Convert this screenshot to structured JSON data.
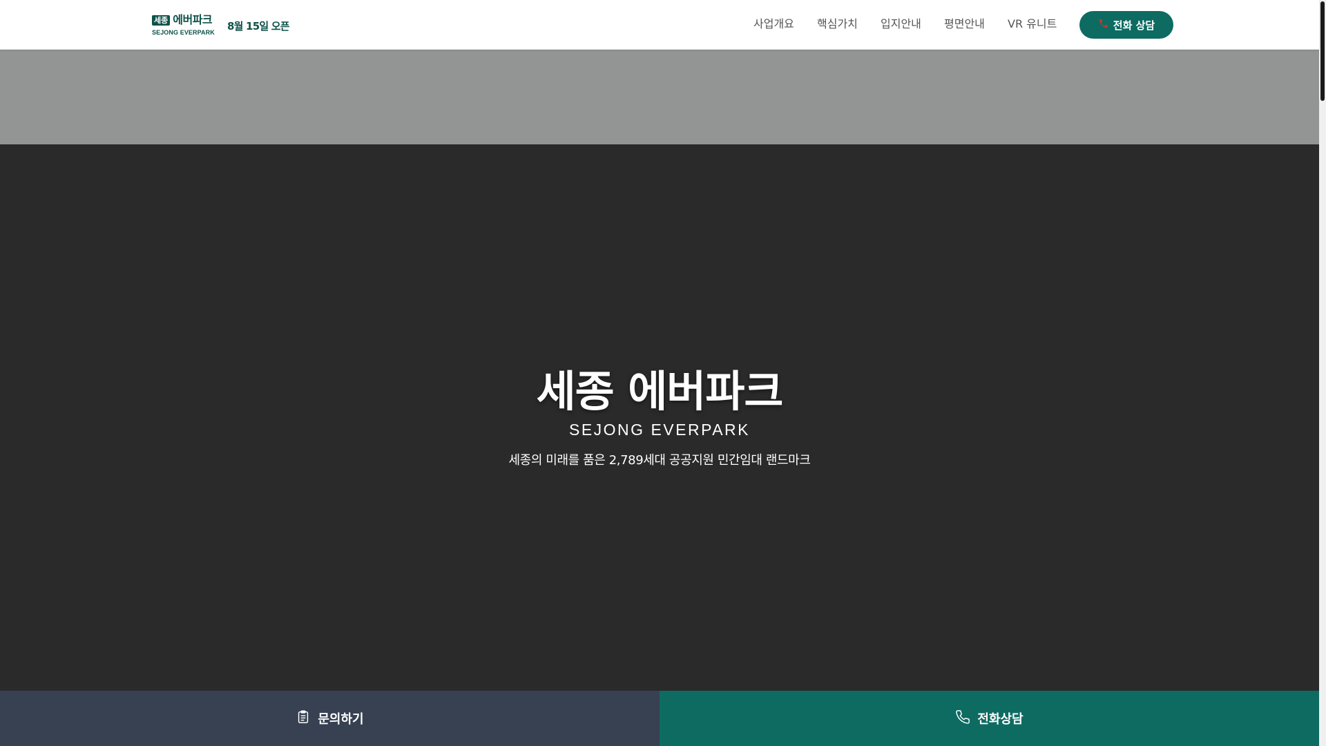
{
  "header": {
    "logo_badge": "세종",
    "logo_name": "에버파크",
    "logo_sub": "SEJONG EVERPARK",
    "open_date": "8월 15일 오픈",
    "nav": [
      "사업개요",
      "핵심가치",
      "입지안내",
      "평면안내",
      "VR 유니트"
    ],
    "cta_label": "전화 상담",
    "cta_icon": "phone-icon"
  },
  "hero": {
    "title": "세종 에버파크",
    "subtitle": "SEJONG EVERPARK",
    "description": "세종의 미래를 품은 2,789세대 공공지원 민간임대 랜드마크"
  },
  "bottom_bar": {
    "inquiry_label": "문의하기",
    "inquiry_icon": "clipboard-icon",
    "call_label": "전화상담",
    "call_icon": "phone-icon"
  },
  "colors": {
    "brand": "#0e6b62",
    "brand_dark": "#0e524a",
    "inquiry_bg": "#374152",
    "hero_bg": "#2a2a2a",
    "band_bg": "#929594"
  }
}
